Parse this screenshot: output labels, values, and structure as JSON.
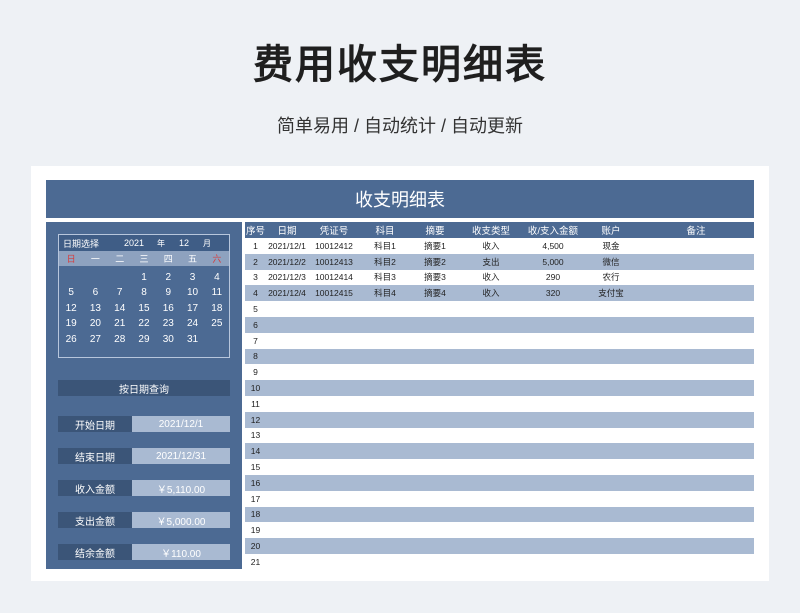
{
  "page": {
    "title": "费用收支明细表",
    "subtitle": "简单易用 / 自动统计 / 自动更新"
  },
  "sheet": {
    "header": "收支明细表",
    "calendar": {
      "label": "日期选择",
      "year": "2021",
      "year_unit": "年",
      "month": "12",
      "month_unit": "月",
      "weekdays": [
        "日",
        "一",
        "二",
        "三",
        "四",
        "五",
        "六"
      ],
      "weeks": [
        [
          "",
          "",
          "",
          "1",
          "2",
          "3",
          "4"
        ],
        [
          "5",
          "6",
          "7",
          "8",
          "9",
          "10",
          "11"
        ],
        [
          "12",
          "13",
          "14",
          "15",
          "16",
          "17",
          "18"
        ],
        [
          "19",
          "20",
          "21",
          "22",
          "23",
          "24",
          "25"
        ],
        [
          "26",
          "27",
          "28",
          "29",
          "30",
          "31",
          ""
        ]
      ]
    },
    "query_button": "按日期查询",
    "stats": [
      {
        "label": "开始日期",
        "value": "2021/12/1"
      },
      {
        "label": "结束日期",
        "value": "2021/12/31"
      },
      {
        "label": "收入金额",
        "value": "￥5,110.00"
      },
      {
        "label": "支出金额",
        "value": "￥5,000.00"
      },
      {
        "label": "结余金额",
        "value": "￥110.00"
      }
    ],
    "columns": [
      "序号",
      "日期",
      "凭证号",
      "科目",
      "摘要",
      "收支类型",
      "收/支入金额",
      "账户",
      "备注"
    ],
    "rows": [
      [
        "1",
        "2021/12/1",
        "10012412",
        "科目1",
        "摘要1",
        "收入",
        "4,500",
        "现金",
        ""
      ],
      [
        "2",
        "2021/12/2",
        "10012413",
        "科目2",
        "摘要2",
        "支出",
        "5,000",
        "微信",
        ""
      ],
      [
        "3",
        "2021/12/3",
        "10012414",
        "科目3",
        "摘要3",
        "收入",
        "290",
        "农行",
        ""
      ],
      [
        "4",
        "2021/12/4",
        "10012415",
        "科目4",
        "摘要4",
        "收入",
        "320",
        "支付宝",
        ""
      ],
      [
        "5",
        "",
        "",
        "",
        "",
        "",
        "",
        "",
        ""
      ],
      [
        "6",
        "",
        "",
        "",
        "",
        "",
        "",
        "",
        ""
      ],
      [
        "7",
        "",
        "",
        "",
        "",
        "",
        "",
        "",
        ""
      ],
      [
        "8",
        "",
        "",
        "",
        "",
        "",
        "",
        "",
        ""
      ],
      [
        "9",
        "",
        "",
        "",
        "",
        "",
        "",
        "",
        ""
      ],
      [
        "10",
        "",
        "",
        "",
        "",
        "",
        "",
        "",
        ""
      ],
      [
        "11",
        "",
        "",
        "",
        "",
        "",
        "",
        "",
        ""
      ],
      [
        "12",
        "",
        "",
        "",
        "",
        "",
        "",
        "",
        ""
      ],
      [
        "13",
        "",
        "",
        "",
        "",
        "",
        "",
        "",
        ""
      ],
      [
        "14",
        "",
        "",
        "",
        "",
        "",
        "",
        "",
        ""
      ],
      [
        "15",
        "",
        "",
        "",
        "",
        "",
        "",
        "",
        ""
      ],
      [
        "16",
        "",
        "",
        "",
        "",
        "",
        "",
        "",
        ""
      ],
      [
        "17",
        "",
        "",
        "",
        "",
        "",
        "",
        "",
        ""
      ],
      [
        "18",
        "",
        "",
        "",
        "",
        "",
        "",
        "",
        ""
      ],
      [
        "19",
        "",
        "",
        "",
        "",
        "",
        "",
        "",
        ""
      ],
      [
        "20",
        "",
        "",
        "",
        "",
        "",
        "",
        "",
        ""
      ],
      [
        "21",
        "",
        "",
        "",
        "",
        "",
        "",
        "",
        ""
      ]
    ]
  },
  "colors": {
    "primary": "#4c6a93",
    "dark": "#3b5578",
    "alt_row": "#a9bad2",
    "background": "#eef1f5",
    "weekend_red": "#d83a3a"
  }
}
